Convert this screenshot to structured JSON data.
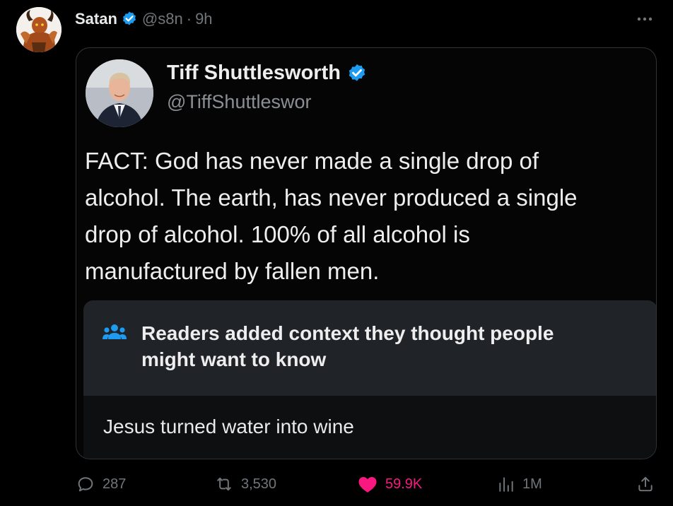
{
  "post": {
    "author_name": "Satan",
    "handle": "@s8n",
    "separator": "·",
    "time": "9h",
    "more_label": "…"
  },
  "quoted_image": {
    "name": "Tiff Shuttlesworth",
    "handle": "@TiffShuttleswor",
    "text_lines": [
      "FACT: God has never made a single drop of",
      "alcohol. The earth, has never produced a single",
      "drop of alcohol. 100% of all alcohol is",
      "manufactured by fallen men."
    ],
    "note": {
      "title_lines": [
        "Readers added context they thought people",
        "might want to know"
      ],
      "body": "Jesus turned water into wine"
    }
  },
  "actions": {
    "replies": "287",
    "reposts": "3,530",
    "likes": "59.9K",
    "views": "1M"
  },
  "icons": {
    "verified": "verified-badge-icon",
    "more": "more-horizontal-icon",
    "reply": "reply-icon",
    "repost": "repost-icon",
    "like": "heart-icon",
    "views": "views-icon",
    "share": "share-icon",
    "note": "community-notes-icon"
  },
  "colors": {
    "background": "#000000",
    "primary_text": "#e7e9ea",
    "secondary_text": "#71767b",
    "verified_blue": "#1d9bf0",
    "like_pink": "#f91880",
    "note_header_bg": "#202327"
  }
}
